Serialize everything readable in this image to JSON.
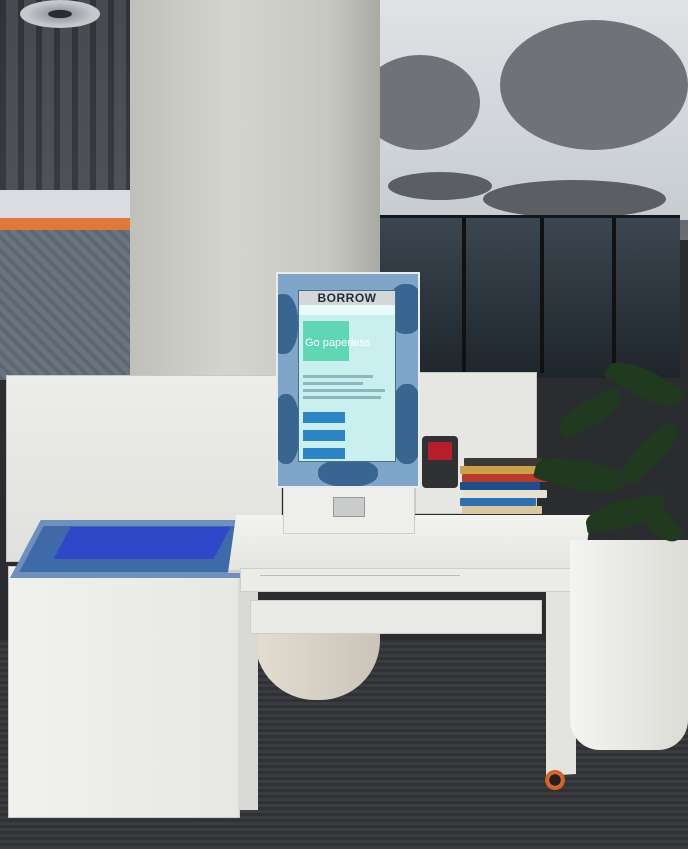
{
  "scene": {
    "kiosk": {
      "screen_title": "BORROW",
      "hero_text": "Go paperless"
    },
    "colors": {
      "kiosk_frame": "#7fa6c8",
      "kiosk_screen": "#c9f0ef",
      "return_bin": "#2f47c9",
      "accent_orange": "#e2773a",
      "card_reader_screen": "#b51f2b"
    },
    "icons": [
      "book-stack-icon",
      "card-reader-icon",
      "plant-icon"
    ]
  }
}
